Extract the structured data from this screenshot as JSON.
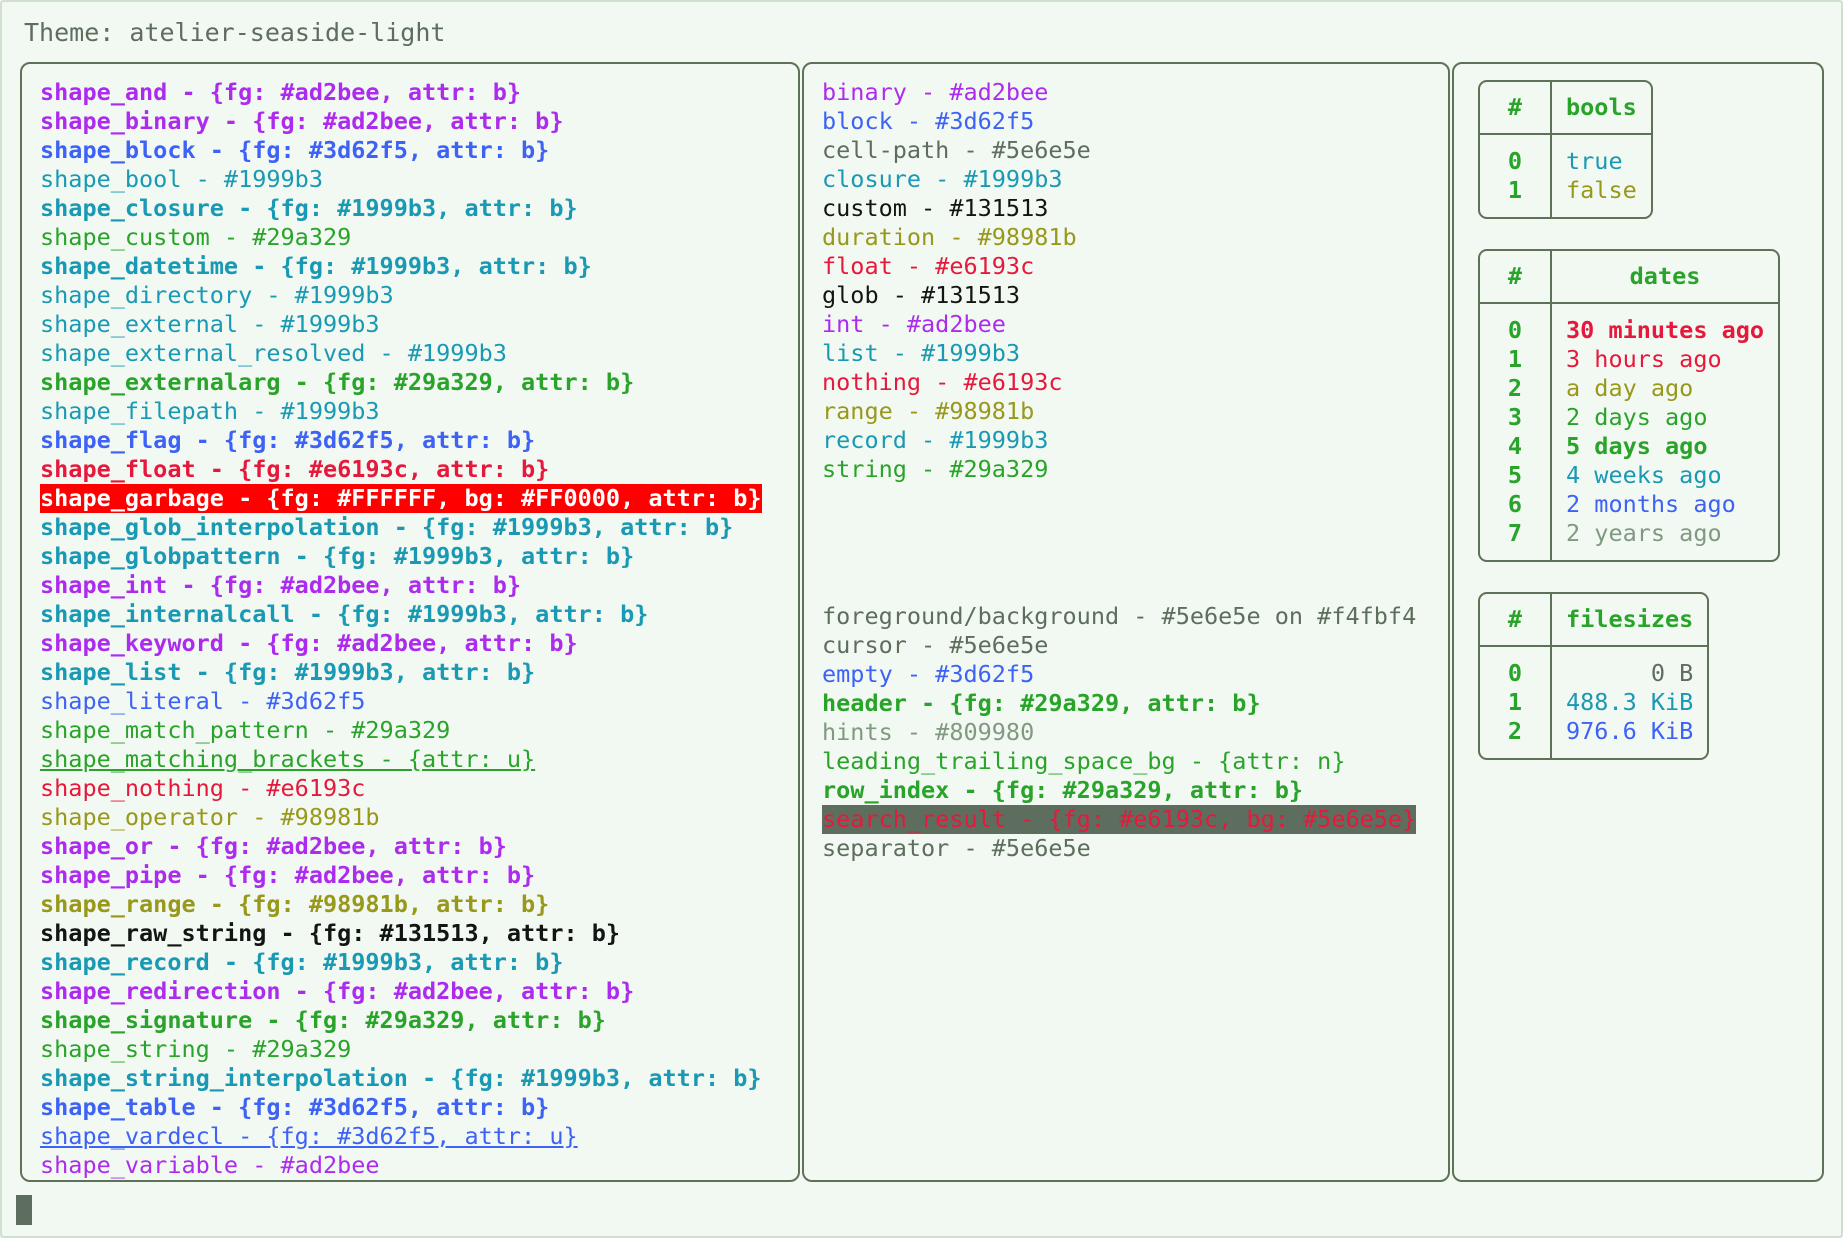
{
  "theme": {
    "label": "Theme: atelier-seaside-light"
  },
  "colors": {
    "background": "#f2f9f2",
    "foreground": "#5e6e5e",
    "border": "#5d7257",
    "purple": "#ad2bee",
    "blue": "#3d62f5",
    "cyan": "#1999b3",
    "green": "#29a329",
    "red": "#e6193c",
    "yellow": "#98981b",
    "black": "#131513",
    "grey": "#809980",
    "garbage_fg": "#FFFFFF",
    "garbage_bg": "#FF0000",
    "search_fg": "#e6193c",
    "search_bg": "#5e6e5e"
  },
  "shapes": [
    {
      "text": "shape_and - {fg: #ad2bee, attr: b}",
      "color": "#ad2bee",
      "bold": true
    },
    {
      "text": "shape_binary - {fg: #ad2bee, attr: b}",
      "color": "#ad2bee",
      "bold": true
    },
    {
      "text": "shape_block - {fg: #3d62f5, attr: b}",
      "color": "#3d62f5",
      "bold": true
    },
    {
      "text": "shape_bool - #1999b3",
      "color": "#1999b3",
      "bold": false
    },
    {
      "text": "shape_closure - {fg: #1999b3, attr: b}",
      "color": "#1999b3",
      "bold": true
    },
    {
      "text": "shape_custom - #29a329",
      "color": "#29a329",
      "bold": false
    },
    {
      "text": "shape_datetime - {fg: #1999b3, attr: b}",
      "color": "#1999b3",
      "bold": true
    },
    {
      "text": "shape_directory - #1999b3",
      "color": "#1999b3",
      "bold": false
    },
    {
      "text": "shape_external - #1999b3",
      "color": "#1999b3",
      "bold": false
    },
    {
      "text": "shape_external_resolved - #1999b3",
      "color": "#1999b3",
      "bold": false
    },
    {
      "text": "shape_externalarg - {fg: #29a329, attr: b}",
      "color": "#29a329",
      "bold": true
    },
    {
      "text": "shape_filepath - #1999b3",
      "color": "#1999b3",
      "bold": false
    },
    {
      "text": "shape_flag - {fg: #3d62f5, attr: b}",
      "color": "#3d62f5",
      "bold": true
    },
    {
      "text": "shape_float - {fg: #e6193c, attr: b}",
      "color": "#e6193c",
      "bold": true
    },
    {
      "text": "shape_garbage - {fg: #FFFFFF, bg: #FF0000, attr: b}",
      "color": "#FFFFFF",
      "bg": "#FF0000",
      "bold": true
    },
    {
      "text": "shape_glob_interpolation - {fg: #1999b3, attr: b}",
      "color": "#1999b3",
      "bold": true
    },
    {
      "text": "shape_globpattern - {fg: #1999b3, attr: b}",
      "color": "#1999b3",
      "bold": true
    },
    {
      "text": "shape_int - {fg: #ad2bee, attr: b}",
      "color": "#ad2bee",
      "bold": true
    },
    {
      "text": "shape_internalcall - {fg: #1999b3, attr: b}",
      "color": "#1999b3",
      "bold": true
    },
    {
      "text": "shape_keyword - {fg: #ad2bee, attr: b}",
      "color": "#ad2bee",
      "bold": true
    },
    {
      "text": "shape_list - {fg: #1999b3, attr: b}",
      "color": "#1999b3",
      "bold": true
    },
    {
      "text": "shape_literal - #3d62f5",
      "color": "#3d62f5",
      "bold": false
    },
    {
      "text": "shape_match_pattern - #29a329",
      "color": "#29a329",
      "bold": false
    },
    {
      "text": "shape_matching_brackets - {attr: u}",
      "color": "#29a329",
      "bold": false,
      "underline": true
    },
    {
      "text": "shape_nothing - #e6193c",
      "color": "#e6193c",
      "bold": false
    },
    {
      "text": "shape_operator - #98981b",
      "color": "#98981b",
      "bold": false
    },
    {
      "text": "shape_or - {fg: #ad2bee, attr: b}",
      "color": "#ad2bee",
      "bold": true
    },
    {
      "text": "shape_pipe - {fg: #ad2bee, attr: b}",
      "color": "#ad2bee",
      "bold": true
    },
    {
      "text": "shape_range - {fg: #98981b, attr: b}",
      "color": "#98981b",
      "bold": true
    },
    {
      "text": "shape_raw_string - {fg: #131513, attr: b}",
      "color": "#131513",
      "bold": true
    },
    {
      "text": "shape_record - {fg: #1999b3, attr: b}",
      "color": "#1999b3",
      "bold": true
    },
    {
      "text": "shape_redirection - {fg: #ad2bee, attr: b}",
      "color": "#ad2bee",
      "bold": true
    },
    {
      "text": "shape_signature - {fg: #29a329, attr: b}",
      "color": "#29a329",
      "bold": true
    },
    {
      "text": "shape_string - #29a329",
      "color": "#29a329",
      "bold": false
    },
    {
      "text": "shape_string_interpolation - {fg: #1999b3, attr: b}",
      "color": "#1999b3",
      "bold": true
    },
    {
      "text": "shape_table - {fg: #3d62f5, attr: b}",
      "color": "#3d62f5",
      "bold": true
    },
    {
      "text": "shape_vardecl - {fg: #3d62f5, attr: u}",
      "color": "#3d62f5",
      "bold": false,
      "underline": true
    },
    {
      "text": "shape_variable - #ad2bee",
      "color": "#ad2bee",
      "bold": false
    }
  ],
  "types": [
    {
      "text": "binary - #ad2bee",
      "color": "#ad2bee",
      "bold": false
    },
    {
      "text": "block - #3d62f5",
      "color": "#3d62f5",
      "bold": false
    },
    {
      "text": "cell-path - #5e6e5e",
      "color": "#5e6e5e",
      "bold": false
    },
    {
      "text": "closure - #1999b3",
      "color": "#1999b3",
      "bold": false
    },
    {
      "text": "custom - #131513",
      "color": "#131513",
      "bold": false
    },
    {
      "text": "duration - #98981b",
      "color": "#98981b",
      "bold": false
    },
    {
      "text": "float - #e6193c",
      "color": "#e6193c",
      "bold": false
    },
    {
      "text": "glob - #131513",
      "color": "#131513",
      "bold": false
    },
    {
      "text": "int - #ad2bee",
      "color": "#ad2bee",
      "bold": false
    },
    {
      "text": "list - #1999b3",
      "color": "#1999b3",
      "bold": false
    },
    {
      "text": "nothing - #e6193c",
      "color": "#e6193c",
      "bold": false
    },
    {
      "text": "range - #98981b",
      "color": "#98981b",
      "bold": false
    },
    {
      "text": "record - #1999b3",
      "color": "#1999b3",
      "bold": false
    },
    {
      "text": "string - #29a329",
      "color": "#29a329",
      "bold": false
    }
  ],
  "ui_elements": [
    {
      "text": "foreground/background - #5e6e5e on #f4fbf4",
      "color": "#5e6e5e",
      "bold": false
    },
    {
      "text": "cursor - #5e6e5e",
      "color": "#5e6e5e",
      "bold": false
    },
    {
      "text": "empty - #3d62f5",
      "color": "#3d62f5",
      "bold": false
    },
    {
      "text": "header - {fg: #29a329, attr: b}",
      "color": "#29a329",
      "bold": true
    },
    {
      "text": "hints - #809980",
      "color": "#809980",
      "bold": false
    },
    {
      "text": "leading_trailing_space_bg - {attr: n}",
      "color": "#29a329",
      "bold": false
    },
    {
      "text": "row_index - {fg: #29a329, attr: b}",
      "color": "#29a329",
      "bold": true
    },
    {
      "text": "search_result - {fg: #e6193c, bg: #5e6e5e}",
      "color": "#e6193c",
      "bg": "#5e6e5e",
      "bold": false
    },
    {
      "text": "separator - #5e6e5e",
      "color": "#5e6e5e",
      "bold": false
    }
  ],
  "tables": [
    {
      "name": "bools",
      "index_header": "#",
      "value_header": "bools",
      "align": "left",
      "rows": [
        {
          "index": "0",
          "value": "true",
          "color": "#1999b3",
          "bold": false
        },
        {
          "index": "1",
          "value": "false",
          "color": "#98981b",
          "bold": false
        }
      ]
    },
    {
      "name": "dates",
      "index_header": "#",
      "value_header": "dates",
      "align": "left",
      "rows": [
        {
          "index": "0",
          "value": "30 minutes ago",
          "color": "#e6193c",
          "bold": true
        },
        {
          "index": "1",
          "value": "3 hours ago",
          "color": "#e6193c",
          "bold": false
        },
        {
          "index": "2",
          "value": "a day ago",
          "color": "#98981b",
          "bold": false
        },
        {
          "index": "3",
          "value": "2 days ago",
          "color": "#29a329",
          "bold": false
        },
        {
          "index": "4",
          "value": "5 days ago",
          "color": "#29a329",
          "bold": true
        },
        {
          "index": "5",
          "value": "4 weeks ago",
          "color": "#1999b3",
          "bold": false
        },
        {
          "index": "6",
          "value": "2 months ago",
          "color": "#3d62f5",
          "bold": false
        },
        {
          "index": "7",
          "value": "2 years ago",
          "color": "#809980",
          "bold": false
        }
      ]
    },
    {
      "name": "filesizes",
      "index_header": "#",
      "value_header": "filesizes",
      "align": "right",
      "rows": [
        {
          "index": "0",
          "value": "0 B",
          "color": "#5e6e5e",
          "bold": false
        },
        {
          "index": "1",
          "value": "488.3 KiB",
          "color": "#1999b3",
          "bold": false
        },
        {
          "index": "2",
          "value": "976.6 KiB",
          "color": "#3d62f5",
          "bold": false
        }
      ]
    }
  ]
}
